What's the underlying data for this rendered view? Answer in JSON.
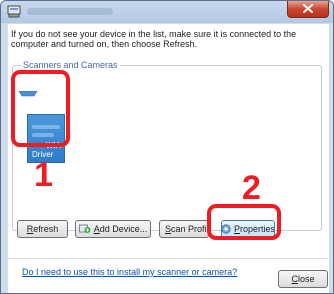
{
  "instructions": "If you do not see your device in the list, make sure it is connected to the computer and turned on, then choose Refresh.",
  "group": {
    "title": "Scanners and Cameras"
  },
  "device": {
    "line1": "WIA",
    "line2": "Driver"
  },
  "annotations": {
    "one": "1",
    "two": "2",
    "color": "#ee1d24"
  },
  "buttons": {
    "refresh": {
      "mnemonic": "R",
      "rest": "efresh"
    },
    "add": {
      "mnemonic": "A",
      "rest": "dd Device..."
    },
    "scan": {
      "mnemonic": "S",
      "rest": "can Profile"
    },
    "properties": {
      "mnemonic": "P",
      "rest": "roperties"
    },
    "close": {
      "mnemonic": "C",
      "rest": "lose"
    }
  },
  "help_link": "Do I need to use this to install my scanner or camera?",
  "icons": {
    "app": "scanner-app-icon",
    "close": "close-icon",
    "add": "add-device-icon",
    "properties": "properties-icon",
    "marker": "device-marker-icon"
  }
}
